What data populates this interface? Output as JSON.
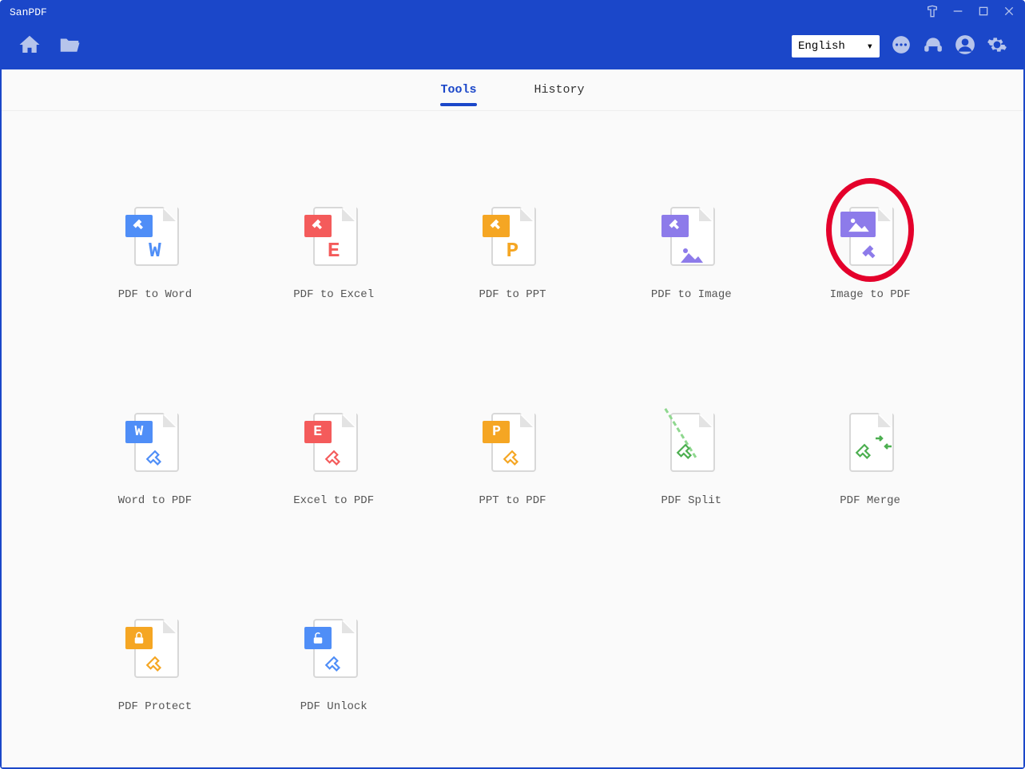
{
  "app": {
    "title": "SanPDF"
  },
  "toolbar": {
    "language": "English"
  },
  "tabs": {
    "tools": "Tools",
    "history": "History",
    "active": "tools"
  },
  "tools": [
    {
      "id": "pdf-to-word",
      "label": "PDF to Word"
    },
    {
      "id": "pdf-to-excel",
      "label": "PDF to Excel"
    },
    {
      "id": "pdf-to-ppt",
      "label": "PDF to PPT"
    },
    {
      "id": "pdf-to-image",
      "label": "PDF to Image"
    },
    {
      "id": "image-to-pdf",
      "label": "Image to PDF",
      "highlighted": true
    },
    {
      "id": "word-to-pdf",
      "label": "Word to PDF"
    },
    {
      "id": "excel-to-pdf",
      "label": "Excel to PDF"
    },
    {
      "id": "ppt-to-pdf",
      "label": "PPT to PDF"
    },
    {
      "id": "pdf-split",
      "label": "PDF Split"
    },
    {
      "id": "pdf-merge",
      "label": "PDF Merge"
    },
    {
      "id": "pdf-protect",
      "label": "PDF Protect"
    },
    {
      "id": "pdf-unlock",
      "label": "PDF Unlock"
    }
  ],
  "colors": {
    "word": "#4f8ef7",
    "excel": "#f45b5b",
    "ppt": "#f5a623",
    "image": "#8d7bea",
    "split": "#4caf50",
    "merge": "#4caf50",
    "protect": "#f5a623",
    "unlock": "#4f8ef7"
  }
}
